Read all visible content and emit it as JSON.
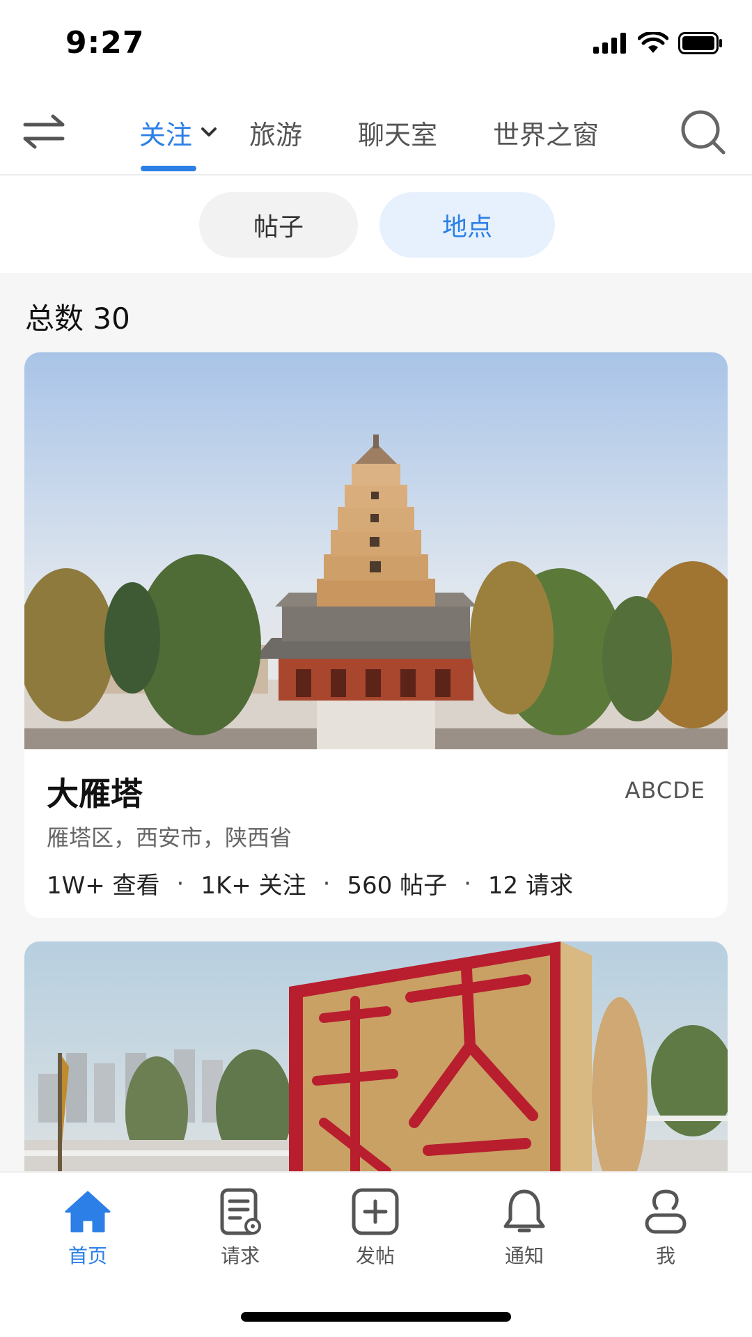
{
  "status": {
    "time": "9:27"
  },
  "header": {
    "tabs": [
      {
        "label": "关注",
        "active": true
      },
      {
        "label": "旅游",
        "active": false
      },
      {
        "label": "聊天室",
        "active": false
      },
      {
        "label": "世界之窗",
        "active": false
      }
    ]
  },
  "filters": {
    "posts": "帖子",
    "places": "地点",
    "active": "places"
  },
  "summary": {
    "total": "总数 30"
  },
  "places": [
    {
      "name": "大雁塔",
      "tag": "ABCDE",
      "address": "雁塔区，西安市，陕西省",
      "stats": {
        "views": "1W+ 查看",
        "follows": "1K+ 关注",
        "posts": "560 帖子",
        "requests": "12 请求"
      }
    }
  ],
  "bottom_nav": [
    {
      "label": "首页",
      "icon": "home-icon",
      "active": true
    },
    {
      "label": "请求",
      "icon": "request-icon",
      "active": false
    },
    {
      "label": "发帖",
      "icon": "add-post-icon",
      "active": false
    },
    {
      "label": "通知",
      "icon": "bell-icon",
      "active": false
    },
    {
      "label": "我",
      "icon": "user-icon",
      "active": false
    }
  ],
  "colors": {
    "accent": "#2b7fe6",
    "pill_active_bg": "#e7f1fd",
    "pill_bg": "#f2f2f3"
  }
}
